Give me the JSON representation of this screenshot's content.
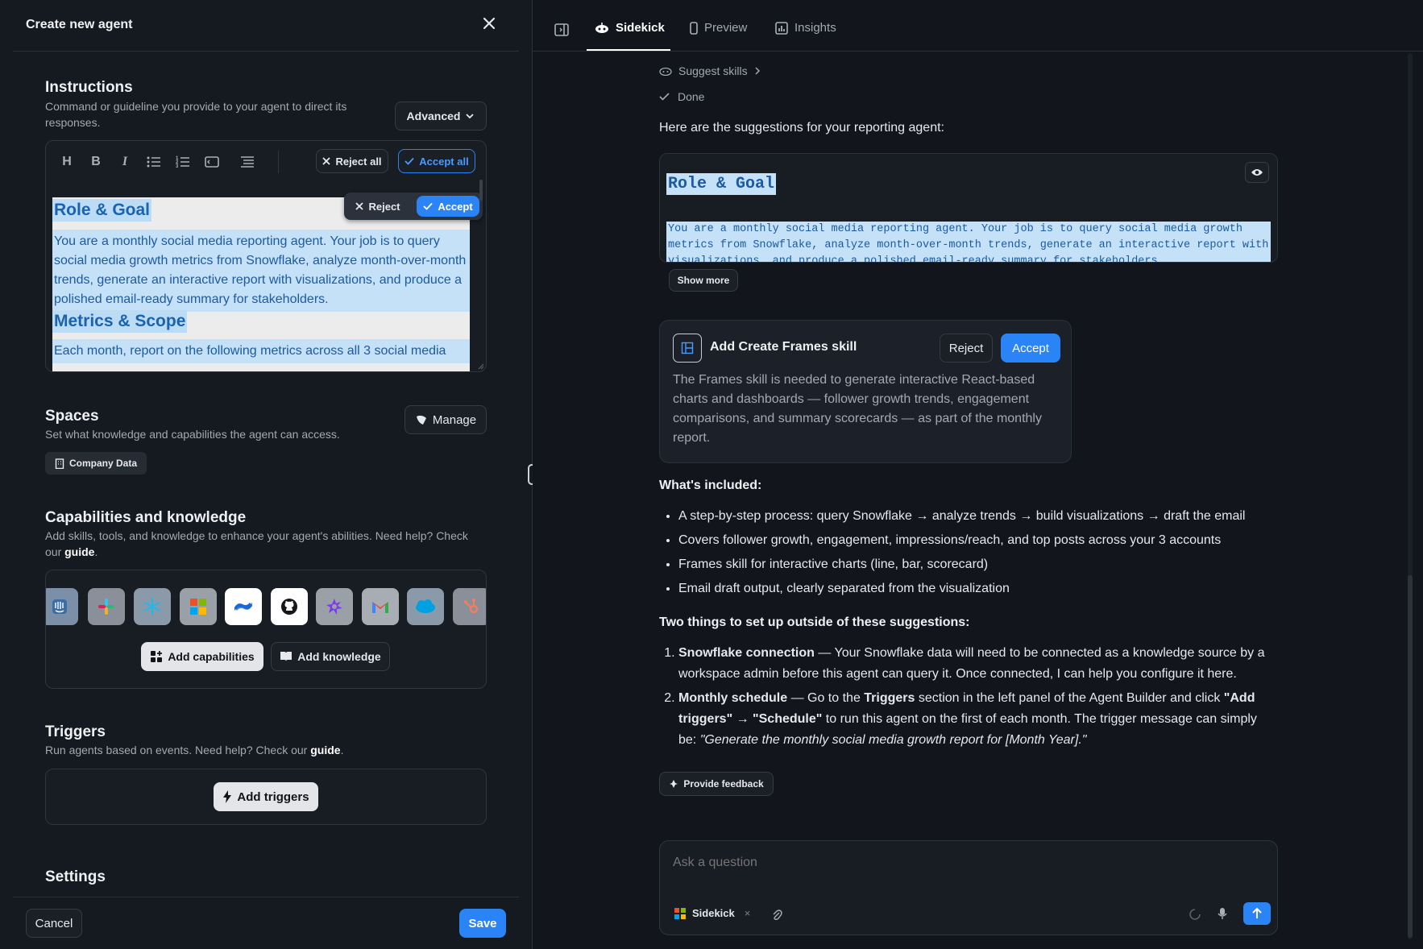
{
  "left_panel": {
    "title": "Create new agent",
    "instructions": {
      "title": "Instructions",
      "description": "Command or guideline you provide to your agent to direct its responses.",
      "mode_label": "Advanced",
      "reject_all": "Reject all",
      "accept_all": "Accept all",
      "reject": "Reject",
      "accept": "Accept",
      "content": {
        "heading1": "Role & Goal",
        "para1": "You are a monthly social media reporting agent. Your job is to query social media growth metrics from Snowflake, analyze month-over-month trends, generate an interactive report with visualizations, and produce a polished email-ready summary for stakeholders.",
        "heading2": "Metrics & Scope",
        "para2": "Each month, report on the following metrics across all 3 social media"
      }
    },
    "spaces": {
      "title": "Spaces",
      "description": "Set what knowledge and capabilities the agent can access.",
      "manage_label": "Manage",
      "chip_label": "Company Data"
    },
    "capabilities": {
      "title": "Capabilities and knowledge",
      "description": "Add skills, tools, and knowledge to enhance your agent's abilities. Need help? Check our",
      "guide_link": "guide",
      "apps": [
        "intercom-icon",
        "slack-icon",
        "snowflake-icon",
        "microsoft-icon",
        "confluence-icon",
        "github-icon",
        "frames-icon",
        "gmail-icon",
        "salesforce-icon",
        "hubspot-icon"
      ],
      "add_capabilities": "Add capabilities",
      "add_knowledge": "Add knowledge"
    },
    "triggers": {
      "title": "Triggers",
      "description": "Run agents based on events. Need help? Check our",
      "guide_link": "guide",
      "add_triggers": "Add triggers"
    },
    "settings": {
      "title": "Settings"
    },
    "footer": {
      "cancel": "Cancel",
      "save": "Save"
    }
  },
  "right_panel": {
    "tabs": [
      {
        "label": "Sidekick",
        "active": true
      },
      {
        "label": "Preview",
        "active": false
      },
      {
        "label": "Insights",
        "active": false
      }
    ],
    "steps": [
      {
        "label": "Suggest skills"
      },
      {
        "label": "Done"
      }
    ],
    "intro": "Here are the suggestions for your reporting agent:",
    "suggestion": {
      "heading": "Role & Goal",
      "line1": "You are a monthly social media reporting agent. Your job is to query social media growth",
      "line2": "metrics from Snowflake, analyze month-over-month trends, generate an interactive report with",
      "line3": "visualizations, and produce a polished email-ready summary for stakeholders.",
      "show_more": "Show more"
    },
    "skill_card": {
      "title": "Add Create Frames skill",
      "reject": "Reject",
      "accept": "Accept",
      "description": "The Frames skill is needed to generate interactive React-based charts and dashboards — follower growth trends, engagement comparisons, and summary scorecards — as part of the monthly report."
    },
    "whats_included": {
      "title": "What's included:",
      "items": [
        "A step-by-step process: query Snowflake → analyze trends → build visualizations → draft the email",
        "Covers follower growth, engagement, impressions/reach, and top posts across your 3 accounts",
        "Frames skill for interactive charts (line, bar, scorecard)",
        "Email draft output, clearly separated from the visualization"
      ]
    },
    "two_things": {
      "title": "Two things to set up outside of these suggestions:",
      "item1_bold": "Snowflake connection",
      "item1_text": " — Your Snowflake data will need to be connected as a knowledge source by a workspace admin before this agent can query it. Once connected, I can help you configure it here.",
      "item2_bold": "Monthly schedule",
      "item2_text_a": " — Go to the ",
      "item2_bold2": "Triggers",
      "item2_text_b": " section in the left panel of the Agent Builder and click ",
      "item2_bold3": "\"Add triggers\"",
      "item2_arrow": " → ",
      "item2_bold4": "\"Schedule\"",
      "item2_text_c": " to run this agent on the first of each month. The trigger message can simply be: ",
      "item2_italic": "\"Generate the monthly social media growth report for [Month Year].\""
    },
    "feedback_label": "Provide feedback",
    "ask": {
      "placeholder": "Ask a question",
      "agent_chip": "Sidekick"
    }
  }
}
